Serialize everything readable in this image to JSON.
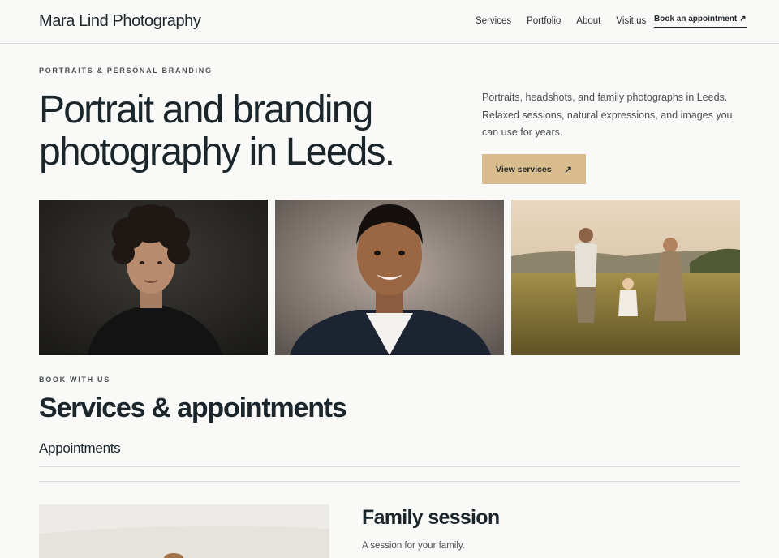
{
  "header": {
    "brand": "Mara Lind Photography",
    "nav": [
      "Services",
      "Portfolio",
      "About",
      "Visit us"
    ],
    "book_label": "Book an appointment",
    "book_arrow": "↗"
  },
  "hero": {
    "eyebrow": "PORTRAITS & PERSONAL BRANDING",
    "title_line1": "Portrait and branding",
    "title_line2": "photography in Leeds.",
    "description": "Portraits, headshots, and family photographs in Leeds. Relaxed sessions, natural expressions, and images you can use for years.",
    "cta_label": "View services",
    "cta_arrow": "↗"
  },
  "services": {
    "eyebrow": "BOOK WITH US",
    "title": "Services & appointments",
    "subtitle": "Appointments",
    "card": {
      "title": "Family session",
      "description": "A session for your family."
    }
  },
  "colors": {
    "background": "#f9f9f8",
    "text": "#1b252c",
    "accent": "#d9bc8c",
    "rule": "#dcdcdc"
  }
}
